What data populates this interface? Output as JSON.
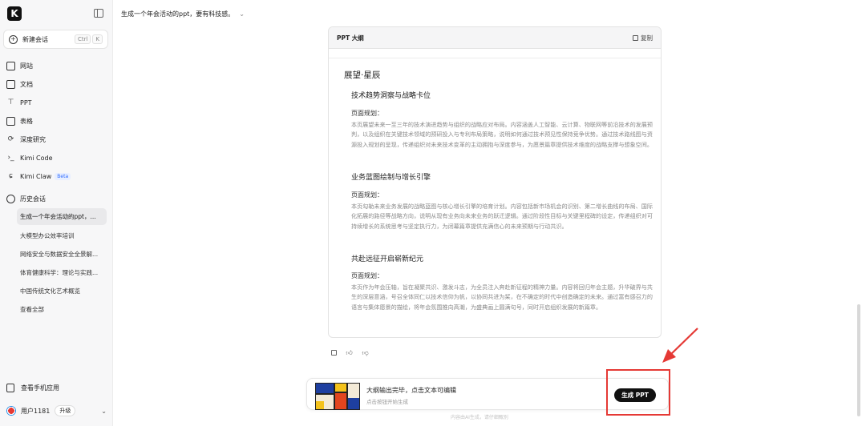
{
  "app": {
    "logo_letter": "K"
  },
  "sidebar": {
    "new_chat_label": "新建会话",
    "shortcut": [
      "Ctrl",
      "K"
    ],
    "nav": [
      {
        "label": "网站",
        "icon": "website-icon"
      },
      {
        "label": "文档",
        "icon": "document-icon"
      },
      {
        "label": "PPT",
        "icon": "ppt-icon"
      },
      {
        "label": "表格",
        "icon": "table-icon"
      },
      {
        "label": "深度研究",
        "icon": "deep-research-icon"
      },
      {
        "label": "Kimi Code",
        "icon": "code-icon"
      },
      {
        "label": "Kimi Claw",
        "icon": "claw-icon",
        "badge": "Beta"
      }
    ],
    "history_label": "历史会话",
    "history": [
      "生成一个年会活动的ppt，...",
      "大模型办公效率培训",
      "网络安全与数据安全全景解...",
      "体育健康科学：理论与实践...",
      "中国传统文化艺术概览",
      "查看全部"
    ],
    "mobile_app_label": "查看手机应用",
    "user_name": "用户1181",
    "upgrade_label": "升级"
  },
  "header": {
    "title": "生成一个年会活动的ppt，要有科技感。"
  },
  "outline": {
    "card_title": "PPT 大纲",
    "copy_label": "复制",
    "doc_title": "展望·星辰",
    "sections": [
      {
        "title": "技术趋势洞察与战略卡位",
        "plan_label": "页面规划：",
        "text": "本页展望未来一至三年的技术演进趋势与组织的战略应对布局。内容涵盖人工智能、云计算、物联网等前沿技术的发展预判，以及组织在关键技术领域的预研投入与专利布局策略，说明如何通过技术预见性保持竞争优势。通过技术路线图与资源投入规划的呈现，传递组织对未来技术变革的主动拥抱与深度参与，为愿景篇章提供技术维度的战略支撑与想象空间。"
      },
      {
        "title": "业务蓝图绘制与增长引擎",
        "plan_label": "页面规划：",
        "text": "本页勾勒未来业务发展的战略蓝图与核心增长引擎的培育计划。内容包括新市场机会的识别、第二增长曲线的布局、国际化拓展的路径等战略方向，说明从现有业务向未来业务的跃迁逻辑。通过阶段性目标与关键里程碑的设定，传递组织对可持续增长的系统思考与坚定执行力，为闭幕篇章提供充满信心的未来预期与行动共识。"
      },
      {
        "title": "共赴远征开启崭新纪元",
        "plan_label": "页面规划：",
        "text": "本页作为年会压轴，旨在凝聚共识、激发斗志，为全员注入奔赴新征程的精神力量。内容将回归年会主题，升华破界与共生的深层意涵，号召全体同仁以技术信仰为帆，以协同共进为桨，在不确定的时代中创造确定的未来。通过富有感召力的语言与集体愿景的描绘，将年会氛围推向高潮，为盛典画上圆满句号，同时开启组织发展的新篇章。"
      }
    ]
  },
  "banner": {
    "title": "大纲输出完毕，点击文本可编辑",
    "subtitle": "点击按钮开始生成",
    "button_label": "生成 PPT"
  },
  "footer_note": "内容由AI生成，请仔细甄别",
  "colors": {
    "highlight": "#e53935",
    "button_bg": "#111111",
    "beta": "#2f6bff"
  }
}
